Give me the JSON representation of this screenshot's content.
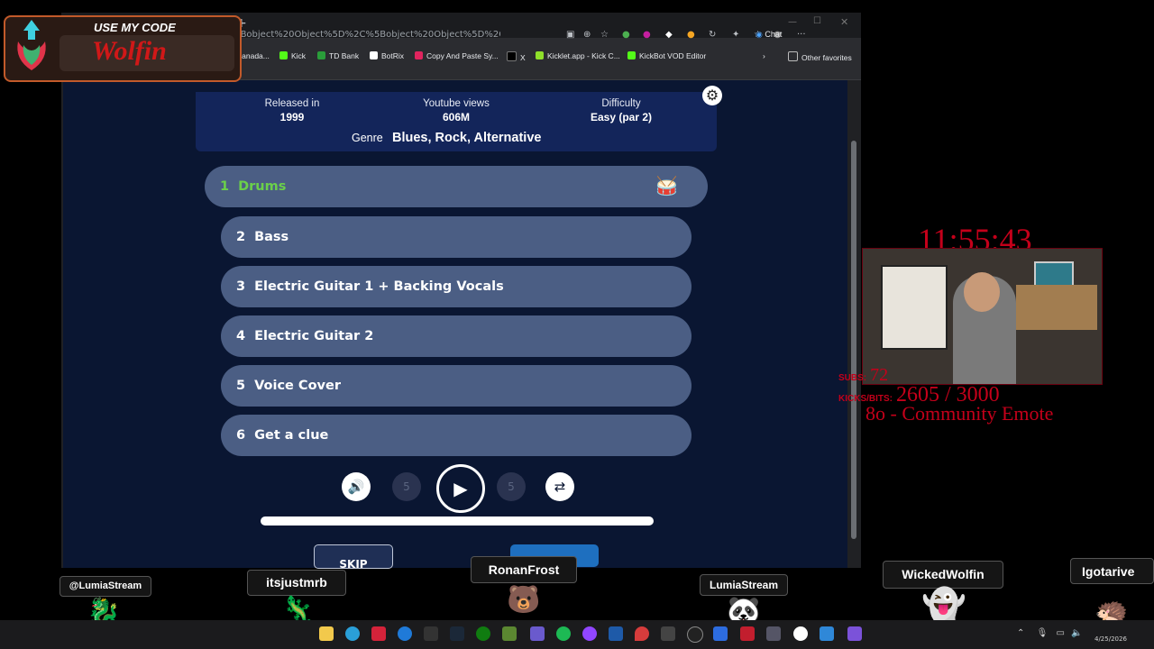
{
  "browser": {
    "url": "e?playlist=%5Bobject%20Object%5D%2C%5Bobject%20Object%5D%2C%5Bobject%...",
    "chat_label": "Chat",
    "bookmarks": [
      "Canada...",
      "Kick",
      "TD Bank",
      "BotRix",
      "Copy And Paste Sy...",
      "X",
      "Kicklet.app - Kick C...",
      "KickBot VOD Editor"
    ],
    "other_favorites": "Other favorites"
  },
  "song_info": {
    "released_label": "Released in",
    "released_value": "1999",
    "views_label": "Youtube views",
    "views_value": "606M",
    "difficulty_label": "Difficulty",
    "difficulty_value": "Easy (par 2)",
    "genre_label": "Genre",
    "genre_value": "Blues, Rock, Alternative"
  },
  "tracks": [
    {
      "num": "1",
      "label": "Drums",
      "active": true
    },
    {
      "num": "2",
      "label": "Bass"
    },
    {
      "num": "3",
      "label": "Electric Guitar 1 + Backing Vocals"
    },
    {
      "num": "4",
      "label": "Electric Guitar 2"
    },
    {
      "num": "5",
      "label": "Voice Cover"
    },
    {
      "num": "6",
      "label": "Get a clue"
    }
  ],
  "controls": {
    "rewind_label": "5",
    "forward_label": "5",
    "skip_label": "SKIP"
  },
  "colors": {
    "active_track_text": "#6bd04a",
    "accent_red": "#c4001a",
    "page_bg": "#0a1632"
  },
  "overlay": {
    "code_title": "USE MY CODE",
    "code_name": "Wolfin",
    "timer": "11:55:43",
    "subs_label": "SUBS:",
    "subs_value": "72",
    "kicks_label": "KICKS/BITS:",
    "kicks_value": "2605 / 3000",
    "goal_text": "8o - Community Emote"
  },
  "chatters": [
    {
      "name": "@LumiaStream",
      "icon": "dragon-icon"
    },
    {
      "name": "itsjustmrb",
      "icon": "lizard-icon"
    },
    {
      "name": "RonanFrost",
      "icon": "bear-icon"
    },
    {
      "name": "LumiaStream",
      "icon": "panda-icon"
    },
    {
      "name": "WickedWolfin",
      "icon": "ghost-icon"
    },
    {
      "name": "Igotarive",
      "icon": "hedgehog-icon"
    }
  ],
  "taskbar": {
    "date": "4/25/2026"
  }
}
